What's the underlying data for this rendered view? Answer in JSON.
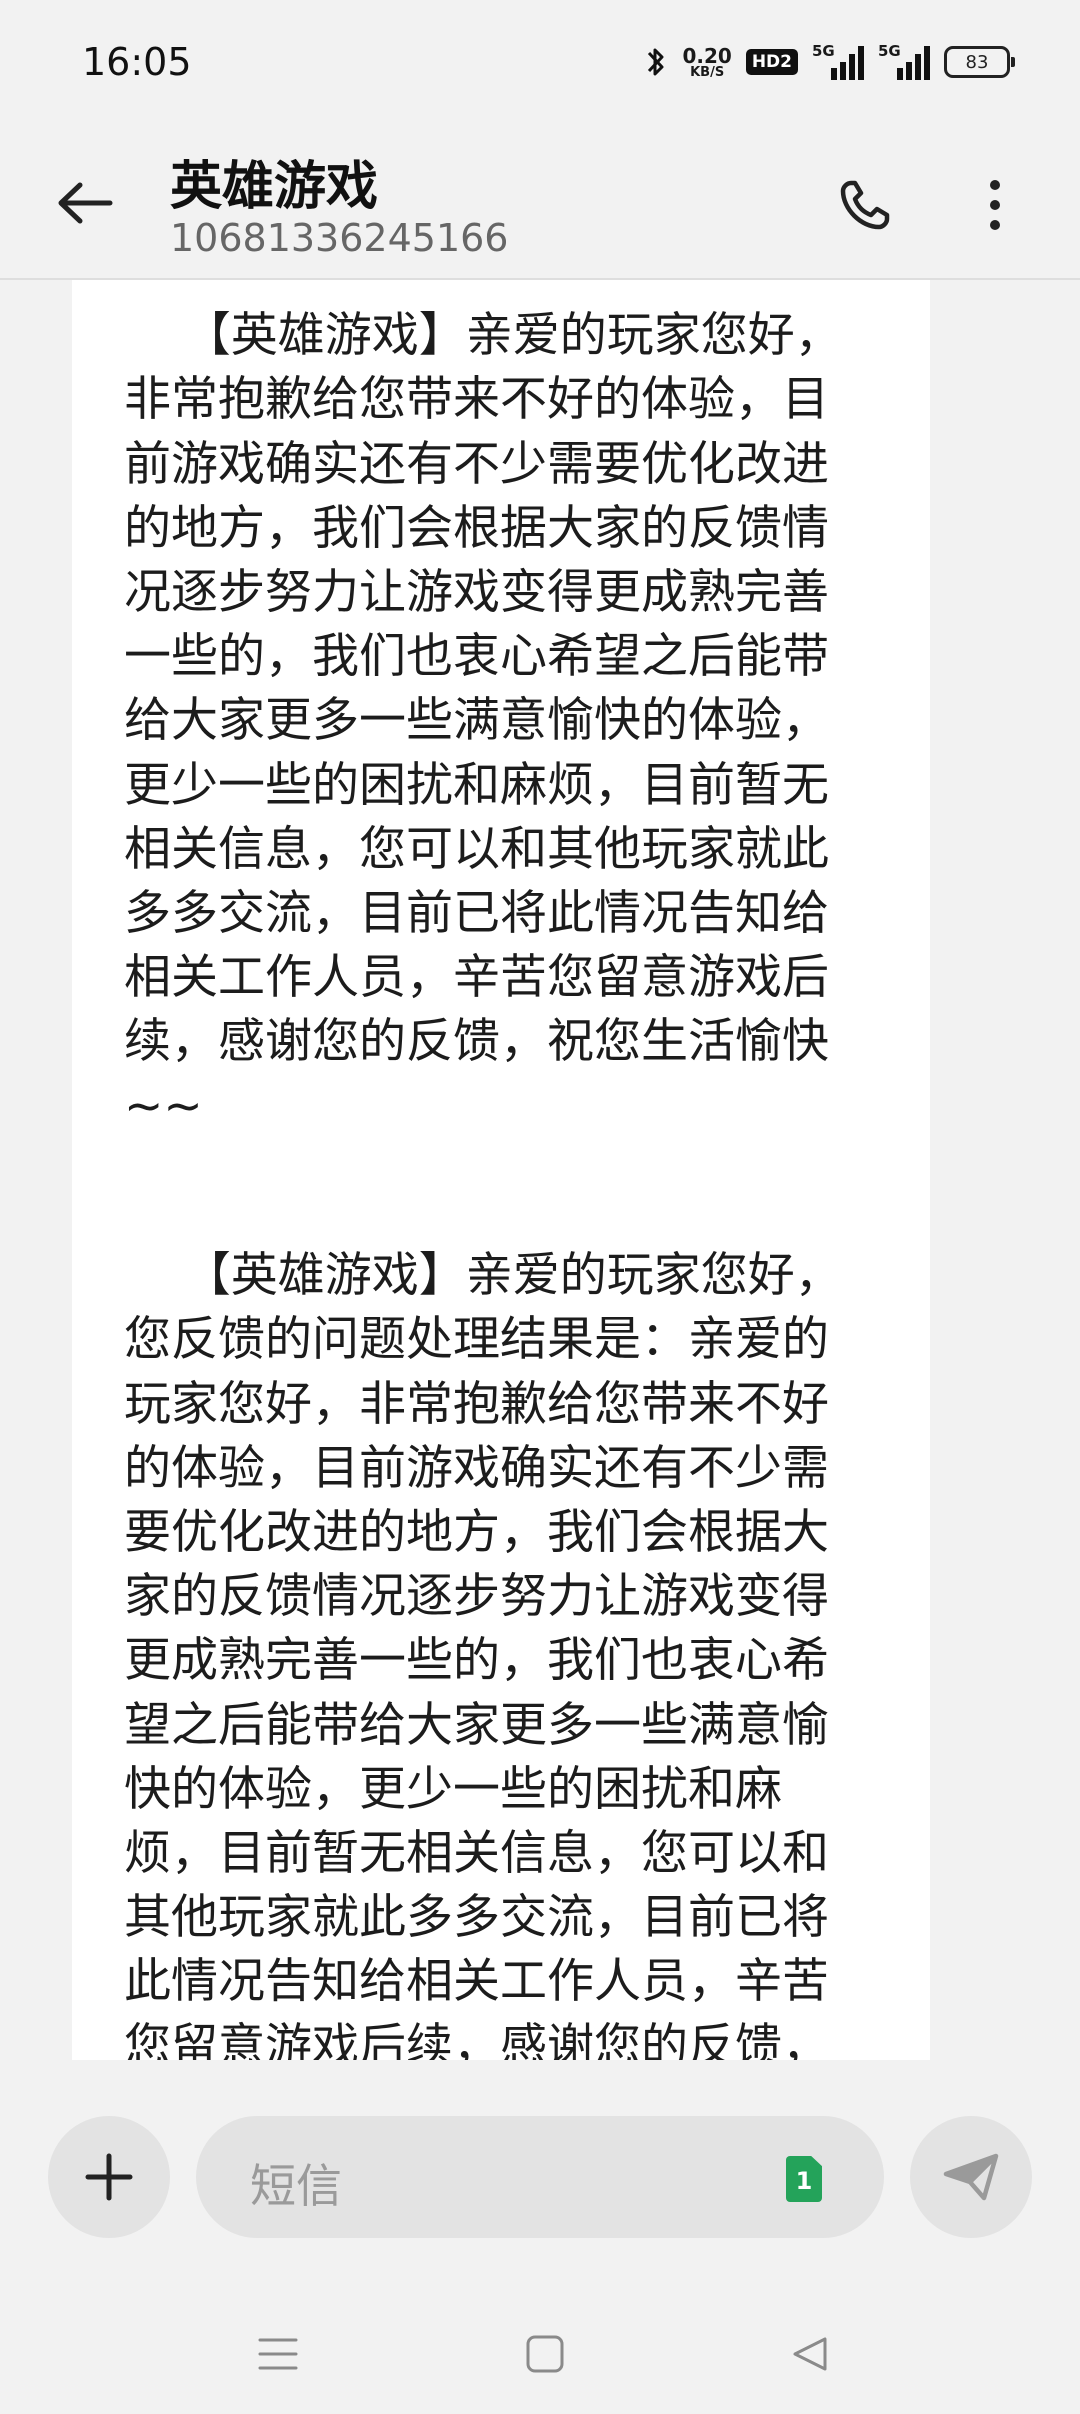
{
  "status_bar": {
    "time": "16:05",
    "net_speed_value": "0.20",
    "net_speed_unit": "KB/S",
    "hd_badge": "HD2",
    "signal_1_label": "5G",
    "signal_2_label": "5G",
    "battery": "83",
    "icons": [
      "bluetooth-icon",
      "hd-voice-icon",
      "signal-icon",
      "signal-icon",
      "battery-icon"
    ]
  },
  "header": {
    "title": "英雄游戏",
    "number": "10681336245166",
    "icons": [
      "back-arrow-icon",
      "phone-icon",
      "more-vertical-icon"
    ]
  },
  "messages": [
    {
      "text": "【英雄游戏】亲爱的玩家您好，非常抱歉给您带来不好的体验，目前游戏确实还有不少需要优化改进的地方，我们会根据大家的反馈情况逐步努力让游戏变得更成熟完善一些的，我们也衷心希望之后能带给大家更多一些满意愉快的体验，更少一些的困扰和麻烦，目前暂无相关信息，您可以和其他玩家就此多多交流，目前已将此情况告知给相关工作人员，辛苦您留意游戏后续，感谢您的反馈，祝您生活愉快~~"
    },
    {
      "text": "【英雄游戏】亲爱的玩家您好，您反馈的问题处理结果是：亲爱的玩家您好，非常抱歉给您带来不好的体验，目前游戏确实还有不少需要优化改进的地方，我们会根据大家的反馈情况逐步努力让游戏变得更成熟完善一些的，我们也衷心希望之后能带给大家更多一些满意愉快的体验，更少一些的困扰和麻烦，目前暂无相关信息，您可以和其他玩家就此多多交流，目前已将此情况告知给相关工作人员，辛苦您留意游戏后续，感谢您的反馈，祝您生活愉快~~。若未能解"
    }
  ],
  "composer": {
    "placeholder": "短信",
    "sim_slot": "1",
    "icons": [
      "plus-icon",
      "sim-card-icon",
      "send-icon"
    ]
  },
  "nav_bar": {
    "icons": [
      "menu-lines-icon",
      "home-square-icon",
      "back-triangle-icon"
    ]
  },
  "colors": {
    "background": "#f2f2f2",
    "bubble": "#ffffff",
    "sim_badge": "#24a35a",
    "button_bg": "#e3e3e3"
  }
}
